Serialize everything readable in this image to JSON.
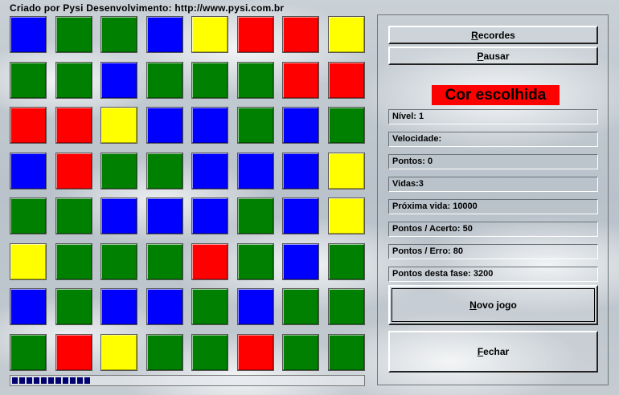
{
  "credit": "Criado por Pysi Desenvolvimento: http://www.pysi.com.br",
  "colors": {
    "B": "#0000ff",
    "G": "#008000",
    "R": "#ff0000",
    "Y": "#ffff00"
  },
  "grid": [
    [
      "B",
      "G",
      "G",
      "B",
      "Y",
      "R",
      "R",
      "Y"
    ],
    [
      "G",
      "G",
      "B",
      "G",
      "G",
      "G",
      "R",
      "R"
    ],
    [
      "R",
      "R",
      "Y",
      "B",
      "B",
      "G",
      "B",
      "G"
    ],
    [
      "B",
      "R",
      "G",
      "G",
      "B",
      "B",
      "B",
      "Y"
    ],
    [
      "G",
      "G",
      "B",
      "B",
      "B",
      "G",
      "B",
      "Y"
    ],
    [
      "Y",
      "G",
      "G",
      "G",
      "R",
      "G",
      "B",
      "G"
    ],
    [
      "B",
      "G",
      "B",
      "B",
      "G",
      "B",
      "G",
      "G"
    ],
    [
      "G",
      "R",
      "Y",
      "G",
      "G",
      "R",
      "G",
      "G"
    ]
  ],
  "progress": {
    "segments": 11,
    "fraction": 0.2
  },
  "buttons": {
    "recordes": {
      "hotkey": "R",
      "rest": "ecordes"
    },
    "pausar": {
      "hotkey": "P",
      "rest": "ausar"
    },
    "novo_jogo": {
      "hotkey": "N",
      "rest": "ovo jogo"
    },
    "fechar": {
      "hotkey": "F",
      "rest": "echar"
    }
  },
  "chosen_color": {
    "label": "Cor escolhida",
    "color": "#ff0000"
  },
  "stats": {
    "nivel": "Nível: 1",
    "velocidade": "Velocidade:",
    "pontos": "Pontos: 0",
    "vidas": "Vidas:3",
    "proxima_vida": "Próxima vida: 10000",
    "pontos_acerto": "Pontos / Acerto: 50",
    "pontos_erro": "Pontos / Erro: 80",
    "pontos_fase": "Pontos desta fase: 3200"
  }
}
